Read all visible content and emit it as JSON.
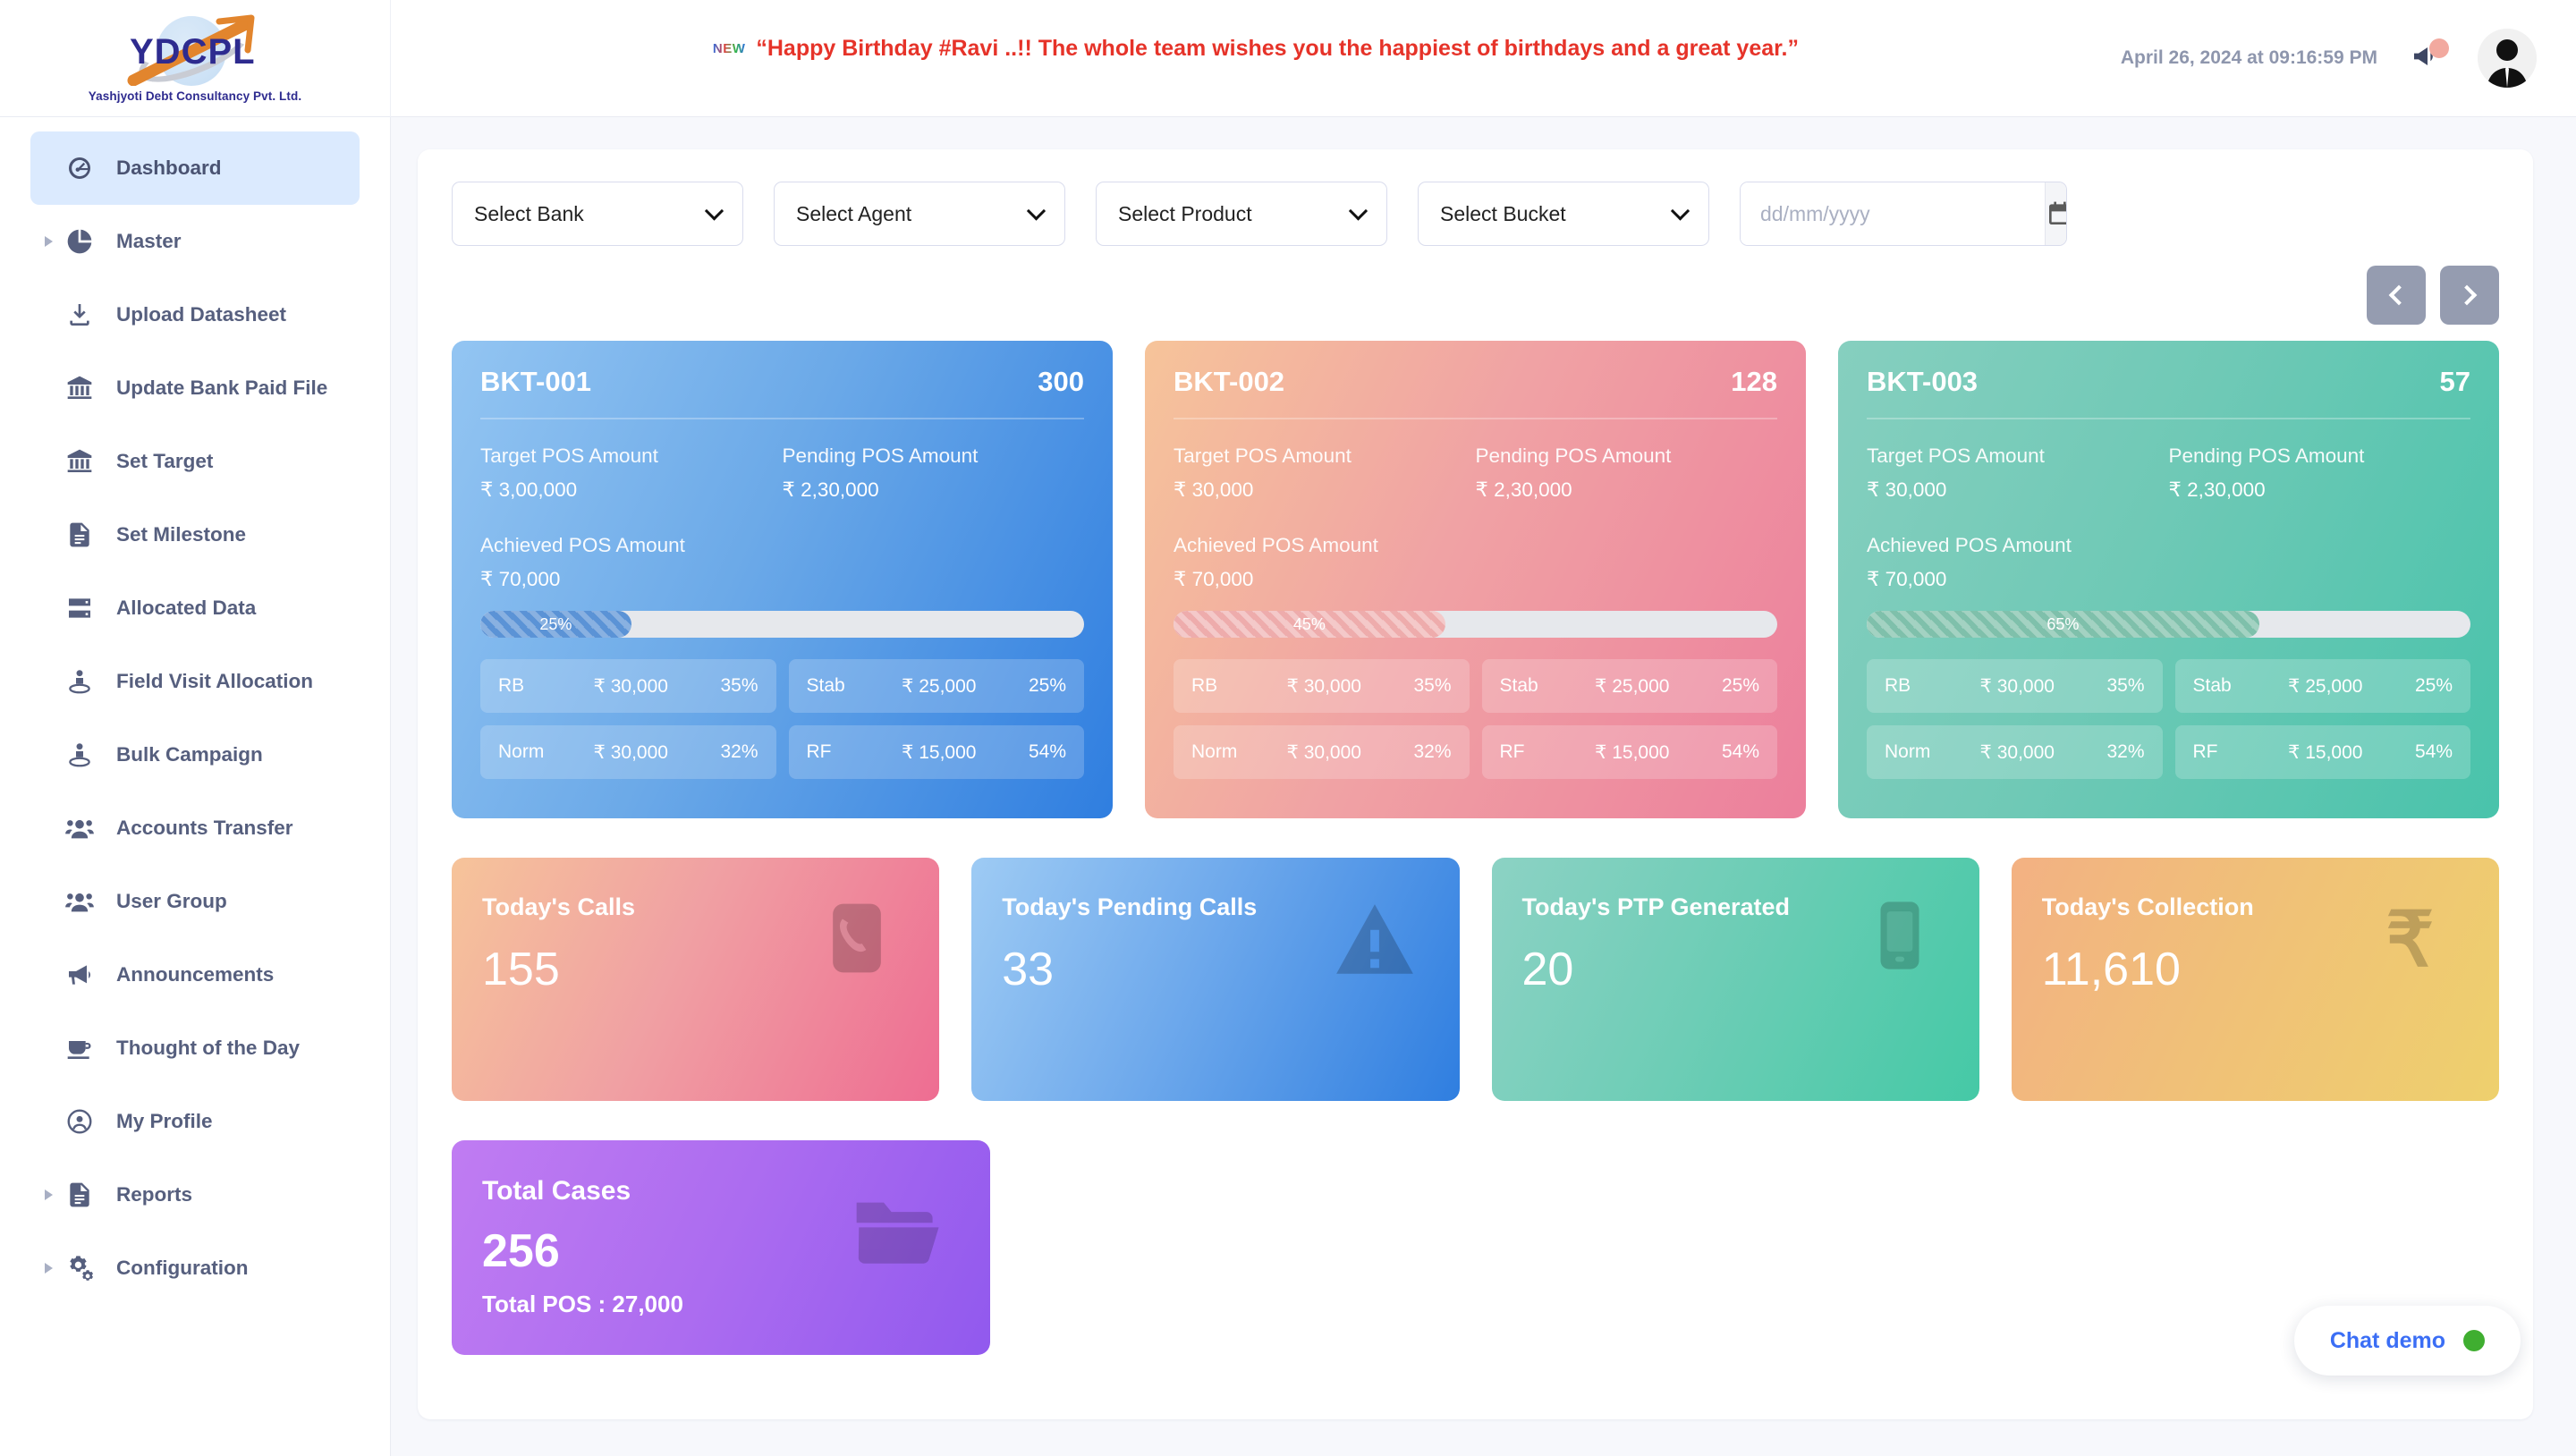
{
  "header": {
    "logo_text": "YDCPL",
    "logo_subtitle": "Yashjyoti Debt Consultancy Pvt. Ltd.",
    "badge_new": "NEW",
    "banner_text": "“Happy Birthday #Ravi ..!! The whole team wishes you the happiest of birthdays and a great year.”",
    "datetime": "April 26, 2024 at 09:16:59 PM",
    "notification_icon": "megaphone-icon",
    "avatar_icon": "user-avatar"
  },
  "sidebar": {
    "items": [
      {
        "label": "Dashboard",
        "icon": "dashboard-icon",
        "active": true,
        "expandable": false
      },
      {
        "label": "Master",
        "icon": "pie-chart-icon",
        "active": false,
        "expandable": true
      },
      {
        "label": "Upload Datasheet",
        "icon": "upload-icon",
        "active": false,
        "expandable": false
      },
      {
        "label": "Update Bank Paid File",
        "icon": "bank-icon",
        "active": false,
        "expandable": false
      },
      {
        "label": "Set Target",
        "icon": "bank-icon",
        "active": false,
        "expandable": false
      },
      {
        "label": "Set Milestone",
        "icon": "document-icon",
        "active": false,
        "expandable": false
      },
      {
        "label": "Allocated Data",
        "icon": "server-icon",
        "active": false,
        "expandable": false
      },
      {
        "label": "Field Visit Allocation",
        "icon": "person-pin-icon",
        "active": false,
        "expandable": false
      },
      {
        "label": "Bulk Campaign",
        "icon": "person-pin-icon",
        "active": false,
        "expandable": false
      },
      {
        "label": "Accounts Transfer",
        "icon": "users-icon",
        "active": false,
        "expandable": false
      },
      {
        "label": "User Group",
        "icon": "users-icon",
        "active": false,
        "expandable": false
      },
      {
        "label": "Announcements",
        "icon": "megaphone-icon",
        "active": false,
        "expandable": false
      },
      {
        "label": "Thought of the Day",
        "icon": "coffee-cup-icon",
        "active": false,
        "expandable": false
      },
      {
        "label": "My Profile",
        "icon": "user-circle-icon",
        "active": false,
        "expandable": false
      },
      {
        "label": "Reports",
        "icon": "document-icon",
        "active": false,
        "expandable": true
      },
      {
        "label": "Configuration",
        "icon": "gears-icon",
        "active": false,
        "expandable": true
      }
    ]
  },
  "filters": {
    "bank": "Select Bank",
    "agent": "Select Agent",
    "product": "Select Product",
    "bucket": "Select Bucket",
    "date_value": "",
    "date_placeholder": "dd/mm/yyyy",
    "calendar_icon": "calendar-icon",
    "prev_label": "‹",
    "next_label": "›"
  },
  "labels": {
    "target": "Target POS Amount",
    "pending": "Pending POS Amount",
    "achieved": "Achieved POS Amount"
  },
  "buckets": [
    {
      "code": "BKT-001",
      "count": "300",
      "target": "₹ 3,00,000",
      "pending": "₹ 2,30,000",
      "achieved": "₹ 70,000",
      "progress": "25%",
      "progress_pct": 25,
      "stats": [
        {
          "key": "RB",
          "value": "₹ 30,000",
          "pct": "35%"
        },
        {
          "key": "Stab",
          "value": "₹ 25,000",
          "pct": "25%"
        },
        {
          "key": "Norm",
          "value": "₹ 30,000",
          "pct": "32%"
        },
        {
          "key": "RF",
          "value": "₹ 15,000",
          "pct": "54%"
        }
      ]
    },
    {
      "code": "BKT-002",
      "count": "128",
      "target": "₹ 30,000",
      "pending": "₹ 2,30,000",
      "achieved": "₹ 70,000",
      "progress": "45%",
      "progress_pct": 45,
      "stats": [
        {
          "key": "RB",
          "value": "₹ 30,000",
          "pct": "35%"
        },
        {
          "key": "Stab",
          "value": "₹ 25,000",
          "pct": "25%"
        },
        {
          "key": "Norm",
          "value": "₹ 30,000",
          "pct": "32%"
        },
        {
          "key": "RF",
          "value": "₹ 15,000",
          "pct": "54%"
        }
      ]
    },
    {
      "code": "BKT-003",
      "count": "57",
      "target": "₹ 30,000",
      "pending": "₹ 2,30,000",
      "achieved": "₹ 70,000",
      "progress": "65%",
      "progress_pct": 65,
      "stats": [
        {
          "key": "RB",
          "value": "₹ 30,000",
          "pct": "35%"
        },
        {
          "key": "Stab",
          "value": "₹ 25,000",
          "pct": "25%"
        },
        {
          "key": "Norm",
          "value": "₹ 30,000",
          "pct": "32%"
        },
        {
          "key": "RF",
          "value": "₹ 15,000",
          "pct": "54%"
        }
      ]
    }
  ],
  "kpis": [
    {
      "title": "Today's Calls",
      "value": "155",
      "icon": "phone-icon"
    },
    {
      "title": "Today's Pending Calls",
      "value": "33",
      "icon": "warning-triangle-icon"
    },
    {
      "title": "Today's PTP Generated",
      "value": "20",
      "icon": "mobile-phone-icon"
    },
    {
      "title": "Today's Collection",
      "value": "11,610",
      "icon": "rupee-icon"
    }
  ],
  "totals": [
    {
      "title": "Total Cases",
      "value": "256",
      "subtitle": "Total POS : 27,000",
      "icon": "folder-icon"
    }
  ],
  "chat": {
    "label": "Chat demo",
    "status_color": "#3fae30"
  }
}
